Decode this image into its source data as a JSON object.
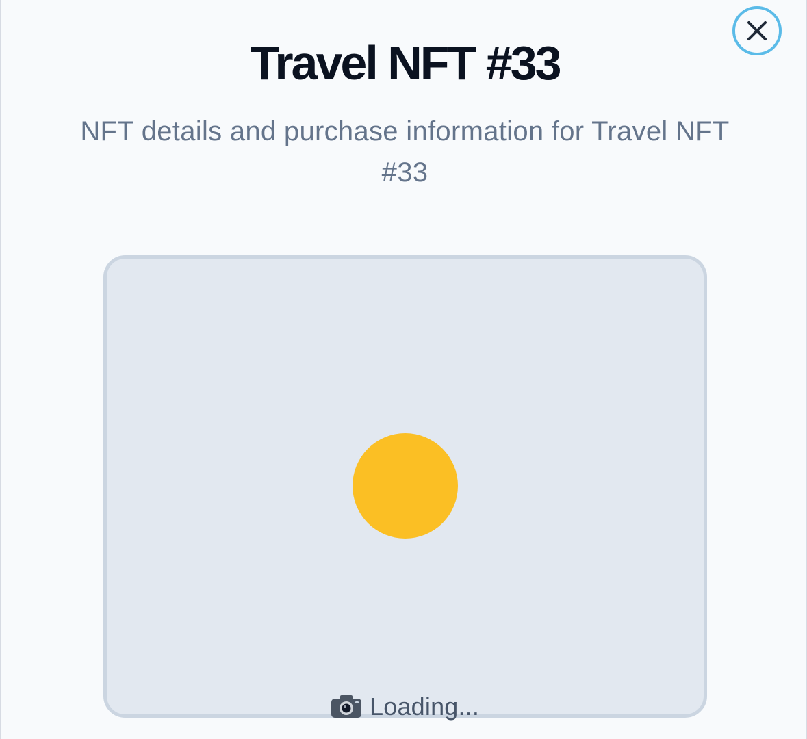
{
  "modal": {
    "title": "Travel NFT #33",
    "subtitle": "NFT details and purchase information for Travel NFT #33",
    "close_icon": "close-icon"
  },
  "image_preview": {
    "status_icon": "camera-icon",
    "status_text": "Loading...",
    "loader_color": "#fbbf24"
  },
  "colors": {
    "background": "#f8fafc",
    "title": "#0b1220",
    "subtitle": "#64748b",
    "frame_fill": "#e2e8f0",
    "frame_border": "#cbd5e1",
    "close_ring": "#5bbbe8"
  }
}
